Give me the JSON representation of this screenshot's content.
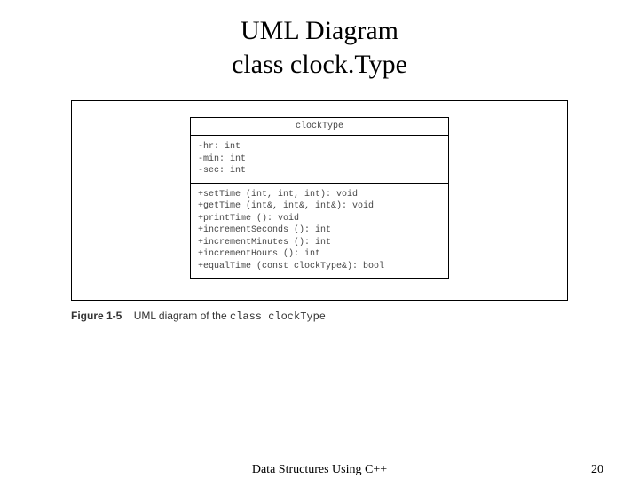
{
  "title": {
    "line1": "UML Diagram",
    "line2": "class clock.Type"
  },
  "uml": {
    "class_name": "clockType",
    "attributes": [
      "-hr: int",
      "-min: int",
      "-sec: int"
    ],
    "operations": [
      "+setTime (int, int, int): void",
      "+getTime (int&, int&, int&): void",
      "+printTime (): void",
      "+incrementSeconds (): int",
      "+incrementMinutes (): int",
      "+incrementHours (): int",
      "+equalTime (const clockType&): bool"
    ]
  },
  "caption": {
    "label": "Figure 1-5",
    "text_prefix": "UML diagram of the ",
    "text_code": "class clockType"
  },
  "footer": {
    "center": "Data Structures Using C++",
    "page": "20"
  }
}
